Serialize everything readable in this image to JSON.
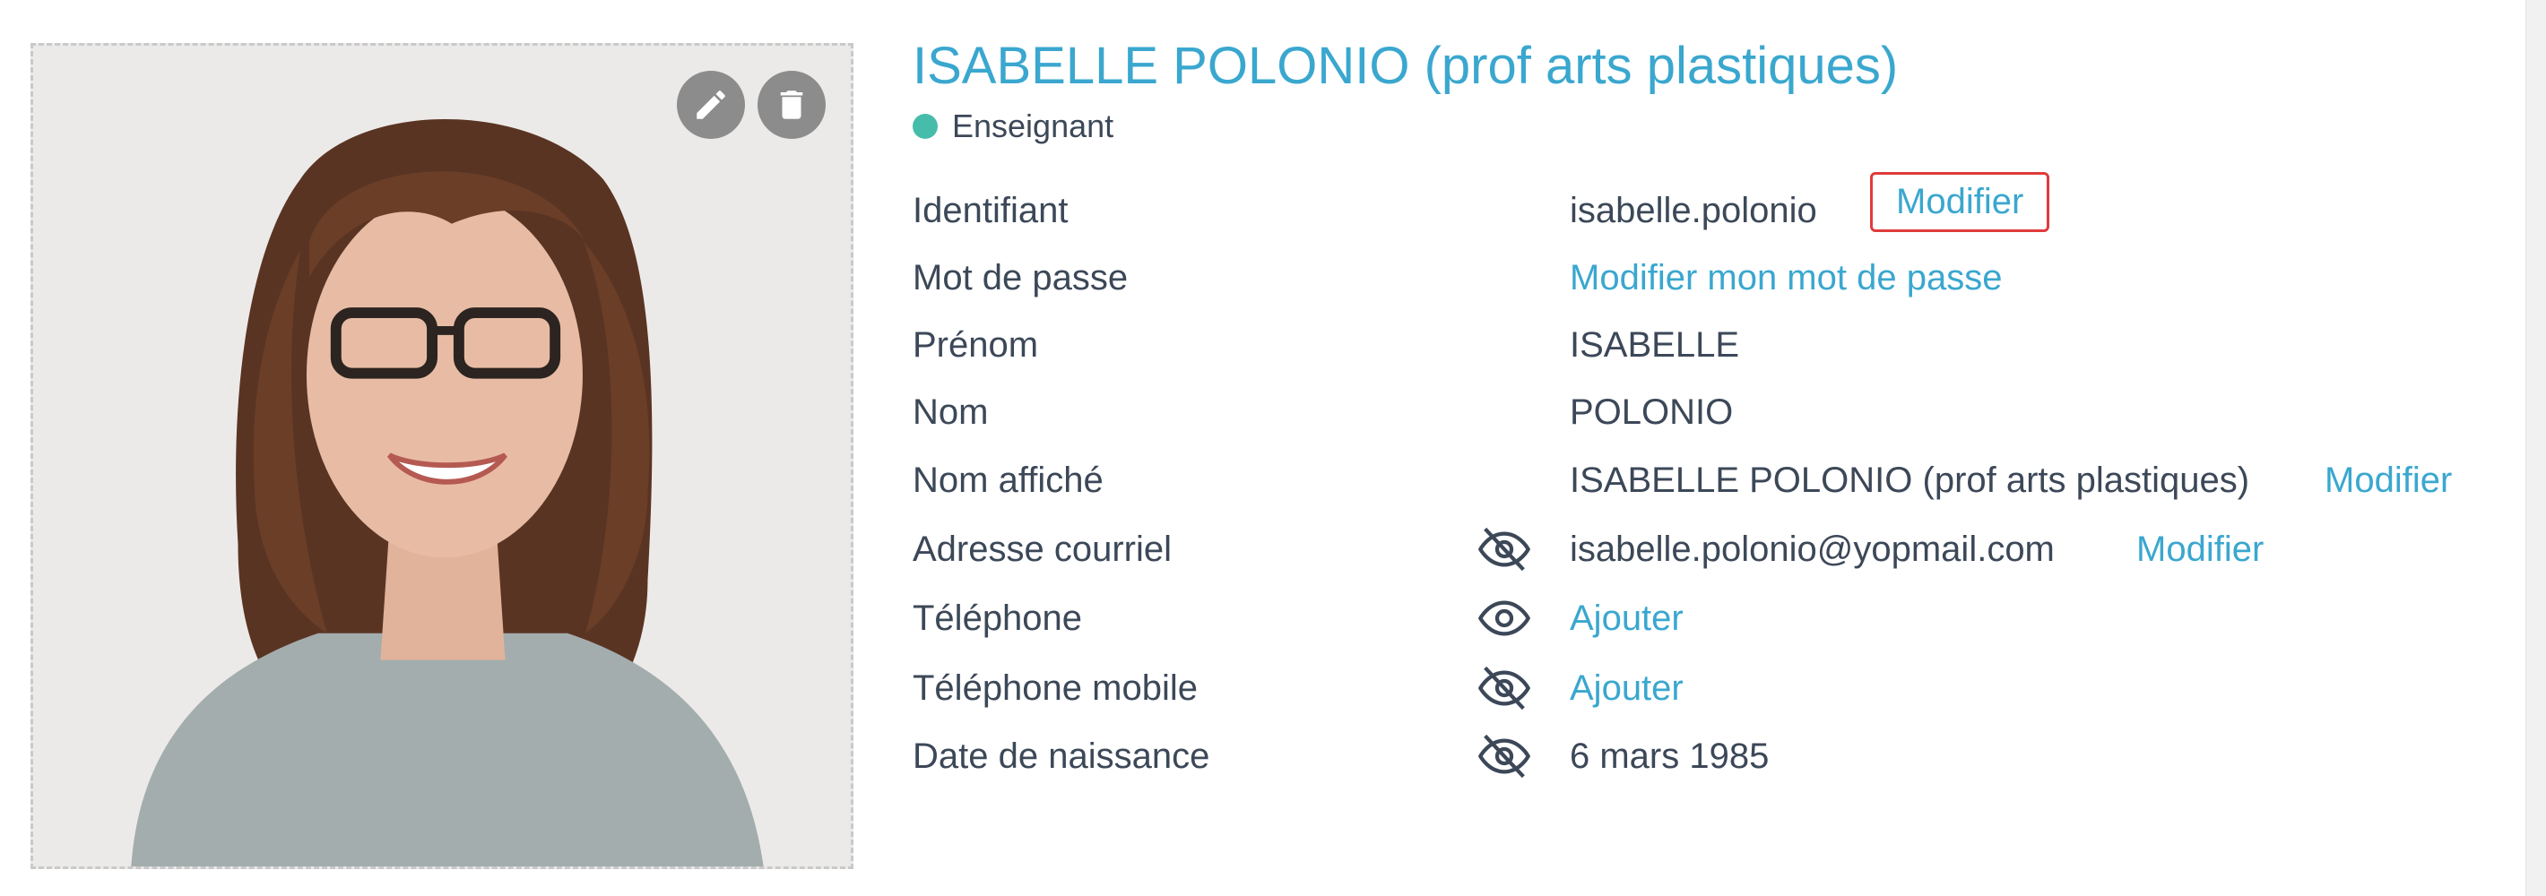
{
  "profile": {
    "display_title": "ISABELLE POLONIO (prof arts plastiques)",
    "role": "Enseignant",
    "role_color": "#46bdaa",
    "accent_color": "#3aa7cf"
  },
  "photo": {
    "edit_icon": "pencil-icon",
    "delete_icon": "trash-icon"
  },
  "fields": {
    "identifiant": {
      "label": "Identifiant",
      "value": "isabelle.polonio",
      "action": "Modifier"
    },
    "password": {
      "label": "Mot de passe",
      "link": "Modifier mon mot de passe"
    },
    "prenom": {
      "label": "Prénom",
      "value": "ISABELLE"
    },
    "nom": {
      "label": "Nom",
      "value": "POLONIO"
    },
    "nom_affiche": {
      "label": "Nom affiché",
      "value": "ISABELLE POLONIO (prof arts plastiques)",
      "action": "Modifier"
    },
    "email": {
      "label": "Adresse courriel",
      "visibility": "eye-off-icon",
      "value": "isabelle.polonio@yopmail.com",
      "action": "Modifier"
    },
    "telephone": {
      "label": "Téléphone",
      "visibility": "eye-icon",
      "link": "Ajouter"
    },
    "mobile": {
      "label": "Téléphone mobile",
      "visibility": "eye-off-icon",
      "link": "Ajouter"
    },
    "birthdate": {
      "label": "Date de naissance",
      "visibility": "eye-off-icon",
      "value": "6 mars 1985"
    }
  }
}
